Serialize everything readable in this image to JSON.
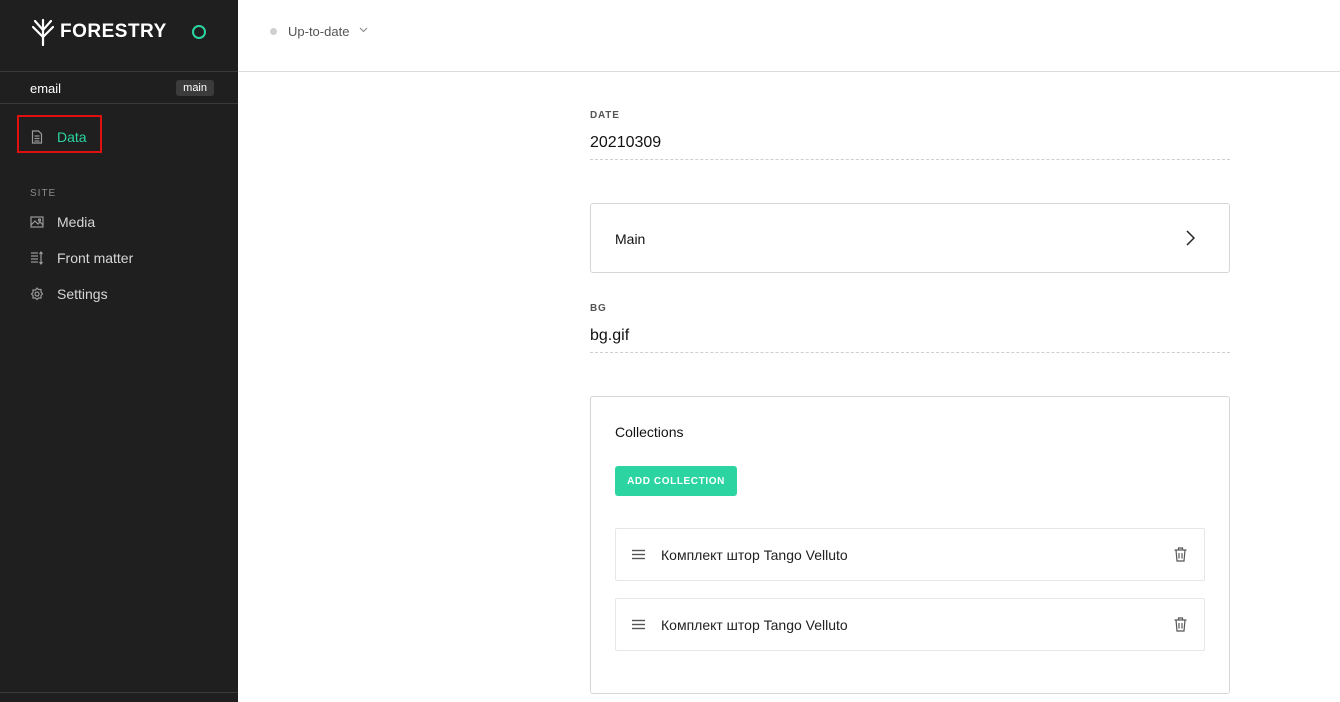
{
  "app": {
    "brand": "FORESTRY",
    "status_color": "#2bd4a0"
  },
  "sidebar": {
    "site_name": "email",
    "branch": "main",
    "primary_items": [
      {
        "label": "Data",
        "icon": "document-icon",
        "active": true
      }
    ],
    "section_label": "SITE",
    "site_items": [
      {
        "label": "Media",
        "icon": "image-icon"
      },
      {
        "label": "Front matter",
        "icon": "front-matter-icon"
      },
      {
        "label": "Settings",
        "icon": "gear-icon"
      }
    ]
  },
  "topbar": {
    "sync_status": "Up-to-date"
  },
  "form": {
    "date": {
      "label": "DATE",
      "value": "20210309"
    },
    "main_group": {
      "label": "Main"
    },
    "bg": {
      "label": "BG",
      "value": "bg.gif"
    },
    "collections": {
      "title": "Collections",
      "add_button": "ADD COLLECTION",
      "items": [
        {
          "label": "Комплект штор Tango Velluto"
        },
        {
          "label": "Комплект штор Tango Velluto"
        }
      ]
    }
  },
  "colors": {
    "accent": "#2bd4a0",
    "sidebar_bg": "#1f1f1f",
    "highlight": "#e01010"
  }
}
